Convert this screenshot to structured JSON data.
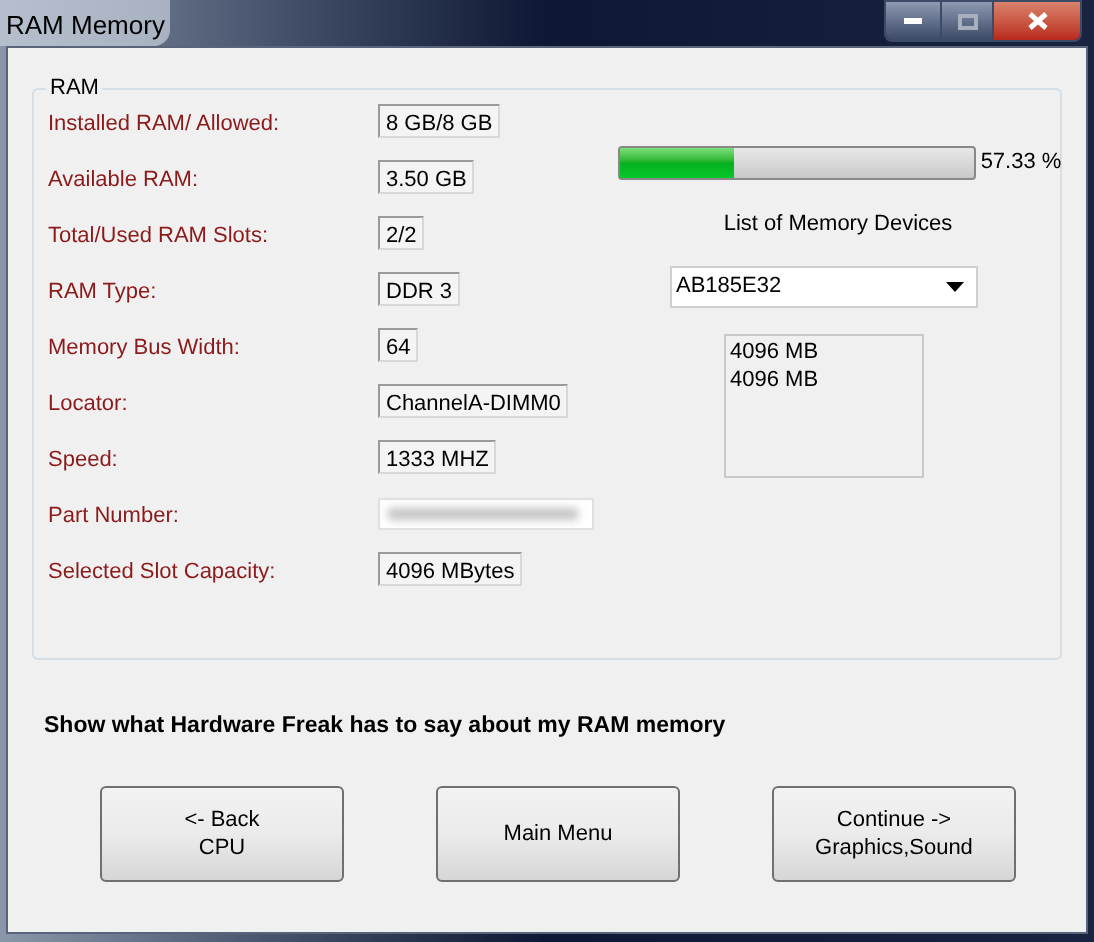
{
  "window": {
    "title": "RAM Memory"
  },
  "group": {
    "title": "RAM"
  },
  "rows": [
    {
      "label": "Installed RAM/ Allowed:",
      "value": "8 GB/8 GB"
    },
    {
      "label": "Available RAM:",
      "value": "3.50 GB"
    },
    {
      "label": "Total/Used RAM Slots:",
      "value": "2/2"
    },
    {
      "label": "RAM Type:",
      "value": "DDR 3"
    },
    {
      "label": "Memory Bus Width:",
      "value": "64"
    },
    {
      "label": "Locator:",
      "value": "ChannelA-DIMM0"
    },
    {
      "label": "Speed:",
      "value": "1333 MHZ"
    },
    {
      "label": "Part Number:",
      "kind": "blurred"
    },
    {
      "label": "Selected Slot Capacity:",
      "value": "4096 MBytes"
    }
  ],
  "usage": {
    "level": 0.32,
    "reading": "57.33 %"
  },
  "devices": {
    "title": "List of Memory Devices",
    "dropdown": "AB185E32",
    "list": [
      "4096 MB",
      "4096 MB"
    ]
  },
  "prompt": "Show what Hardware Freak has to say about my RAM memory",
  "buttons": [
    [
      "<- Back",
      "CPU"
    ],
    [
      "Main Menu"
    ],
    [
      "Continue ->",
      "Graphics,Sound"
    ]
  ]
}
